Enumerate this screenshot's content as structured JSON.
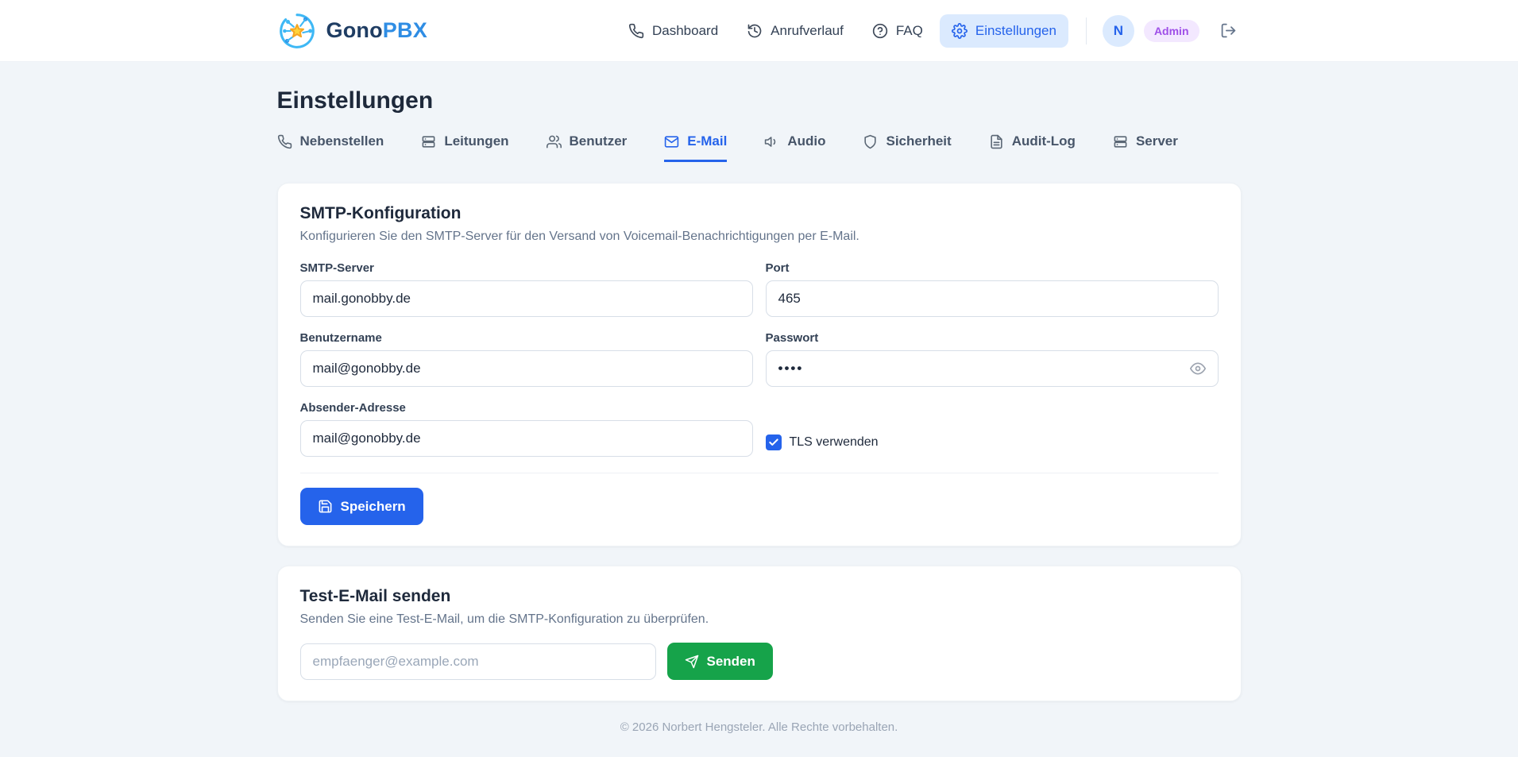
{
  "brand": {
    "name_primary": "Gono",
    "name_secondary": "PBX",
    "logo_icon": "network-star-logo"
  },
  "nav": {
    "items": [
      {
        "label": "Dashboard",
        "icon": "phone-icon",
        "active": false
      },
      {
        "label": "Anrufverlauf",
        "icon": "history-icon",
        "active": false
      },
      {
        "label": "FAQ",
        "icon": "help-circle-icon",
        "active": false
      },
      {
        "label": "Einstellungen",
        "icon": "gear-icon",
        "active": true
      }
    ]
  },
  "user": {
    "avatar_initial": "N",
    "role_badge": "Admin",
    "logout_icon": "logout-icon"
  },
  "page": {
    "title": "Einstellungen"
  },
  "tabs": [
    {
      "label": "Nebenstellen",
      "icon": "phone-icon",
      "active": false
    },
    {
      "label": "Leitungen",
      "icon": "server-rows-icon",
      "active": false
    },
    {
      "label": "Benutzer",
      "icon": "users-icon",
      "active": false
    },
    {
      "label": "E-Mail",
      "icon": "mail-icon",
      "active": true
    },
    {
      "label": "Audio",
      "icon": "speaker-icon",
      "active": false
    },
    {
      "label": "Sicherheit",
      "icon": "shield-icon",
      "active": false
    },
    {
      "label": "Audit-Log",
      "icon": "file-text-icon",
      "active": false
    },
    {
      "label": "Server",
      "icon": "server-rows-icon",
      "active": false
    }
  ],
  "smtp_card": {
    "title": "SMTP-Konfiguration",
    "subtitle": "Konfigurieren Sie den SMTP-Server für den Versand von Voicemail-Benachrichtigungen per E-Mail.",
    "fields": {
      "server": {
        "label": "SMTP-Server",
        "value": "mail.gonobby.de"
      },
      "port": {
        "label": "Port",
        "value": "465"
      },
      "username": {
        "label": "Benutzername",
        "value": "mail@gonobby.de"
      },
      "password": {
        "label": "Passwort",
        "value": "••••"
      },
      "sender": {
        "label": "Absender-Adresse",
        "value": "mail@gonobby.de"
      }
    },
    "tls_checkbox": {
      "label": "TLS verwenden",
      "checked": true
    },
    "save_button": "Speichern"
  },
  "test_card": {
    "title": "Test-E-Mail senden",
    "subtitle": "Senden Sie eine Test-E-Mail, um die SMTP-Konfiguration zu überprüfen.",
    "recipient_placeholder": "empfaenger@example.com",
    "send_button": "Senden"
  },
  "footer": {
    "copyright": "© 2026 Norbert Hengsteler. Alle Rechte vorbehalten."
  },
  "colors": {
    "accent_blue": "#2563eb",
    "active_pill_bg": "#dbeafe",
    "success_green": "#16a34a",
    "admin_badge_bg": "#f3e8ff",
    "admin_badge_text": "#9f4fe8",
    "page_bg": "#f1f5f9",
    "logo_cyan": "#3eb8f5",
    "logo_star_orange": "#f5a623"
  }
}
